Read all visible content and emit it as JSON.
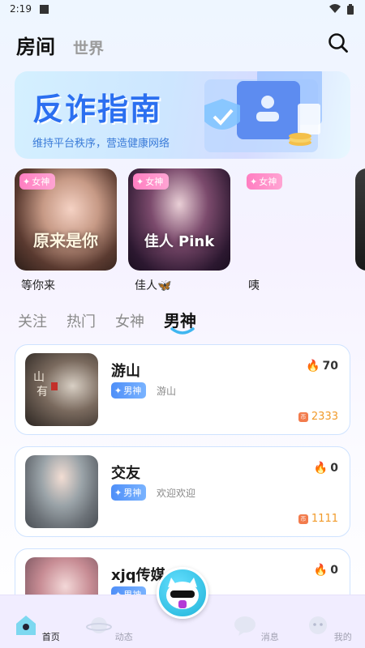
{
  "status": {
    "time": "2:19"
  },
  "header": {
    "tab_room": "房间",
    "tab_world": "世界"
  },
  "banner": {
    "title": "反诈指南",
    "subtitle": "维持平台秩序，营造健康网络"
  },
  "hosts": [
    {
      "badge": "女神",
      "name": "等你来",
      "overlay": "原来是你"
    },
    {
      "badge": "女神",
      "name": "佳人🦋",
      "overlay": "佳人 Pink"
    },
    {
      "badge": "女神",
      "name": "咦",
      "overlay": ""
    }
  ],
  "categories": [
    "关注",
    "热门",
    "女神",
    "男神"
  ],
  "active_category": "男神",
  "rooms": [
    {
      "title": "游山",
      "badge": "男神",
      "desc": "游山",
      "heat": "70",
      "coins": "2333"
    },
    {
      "title": "交友",
      "badge": "男神",
      "desc": "欢迎欢迎",
      "heat": "0",
      "coins": "1111"
    },
    {
      "title": "xjq传媒",
      "badge": "男神",
      "desc": "",
      "heat": "0",
      "coins": ""
    }
  ],
  "bottom_nav": {
    "home": "首页",
    "feed": "动态",
    "messages": "消息",
    "mine": "我的"
  },
  "colors": {
    "accent": "#2b6ff0",
    "female_badge": "#ff7ec1",
    "male_badge": "#4f8ff8",
    "coin": "#f19a2a"
  }
}
